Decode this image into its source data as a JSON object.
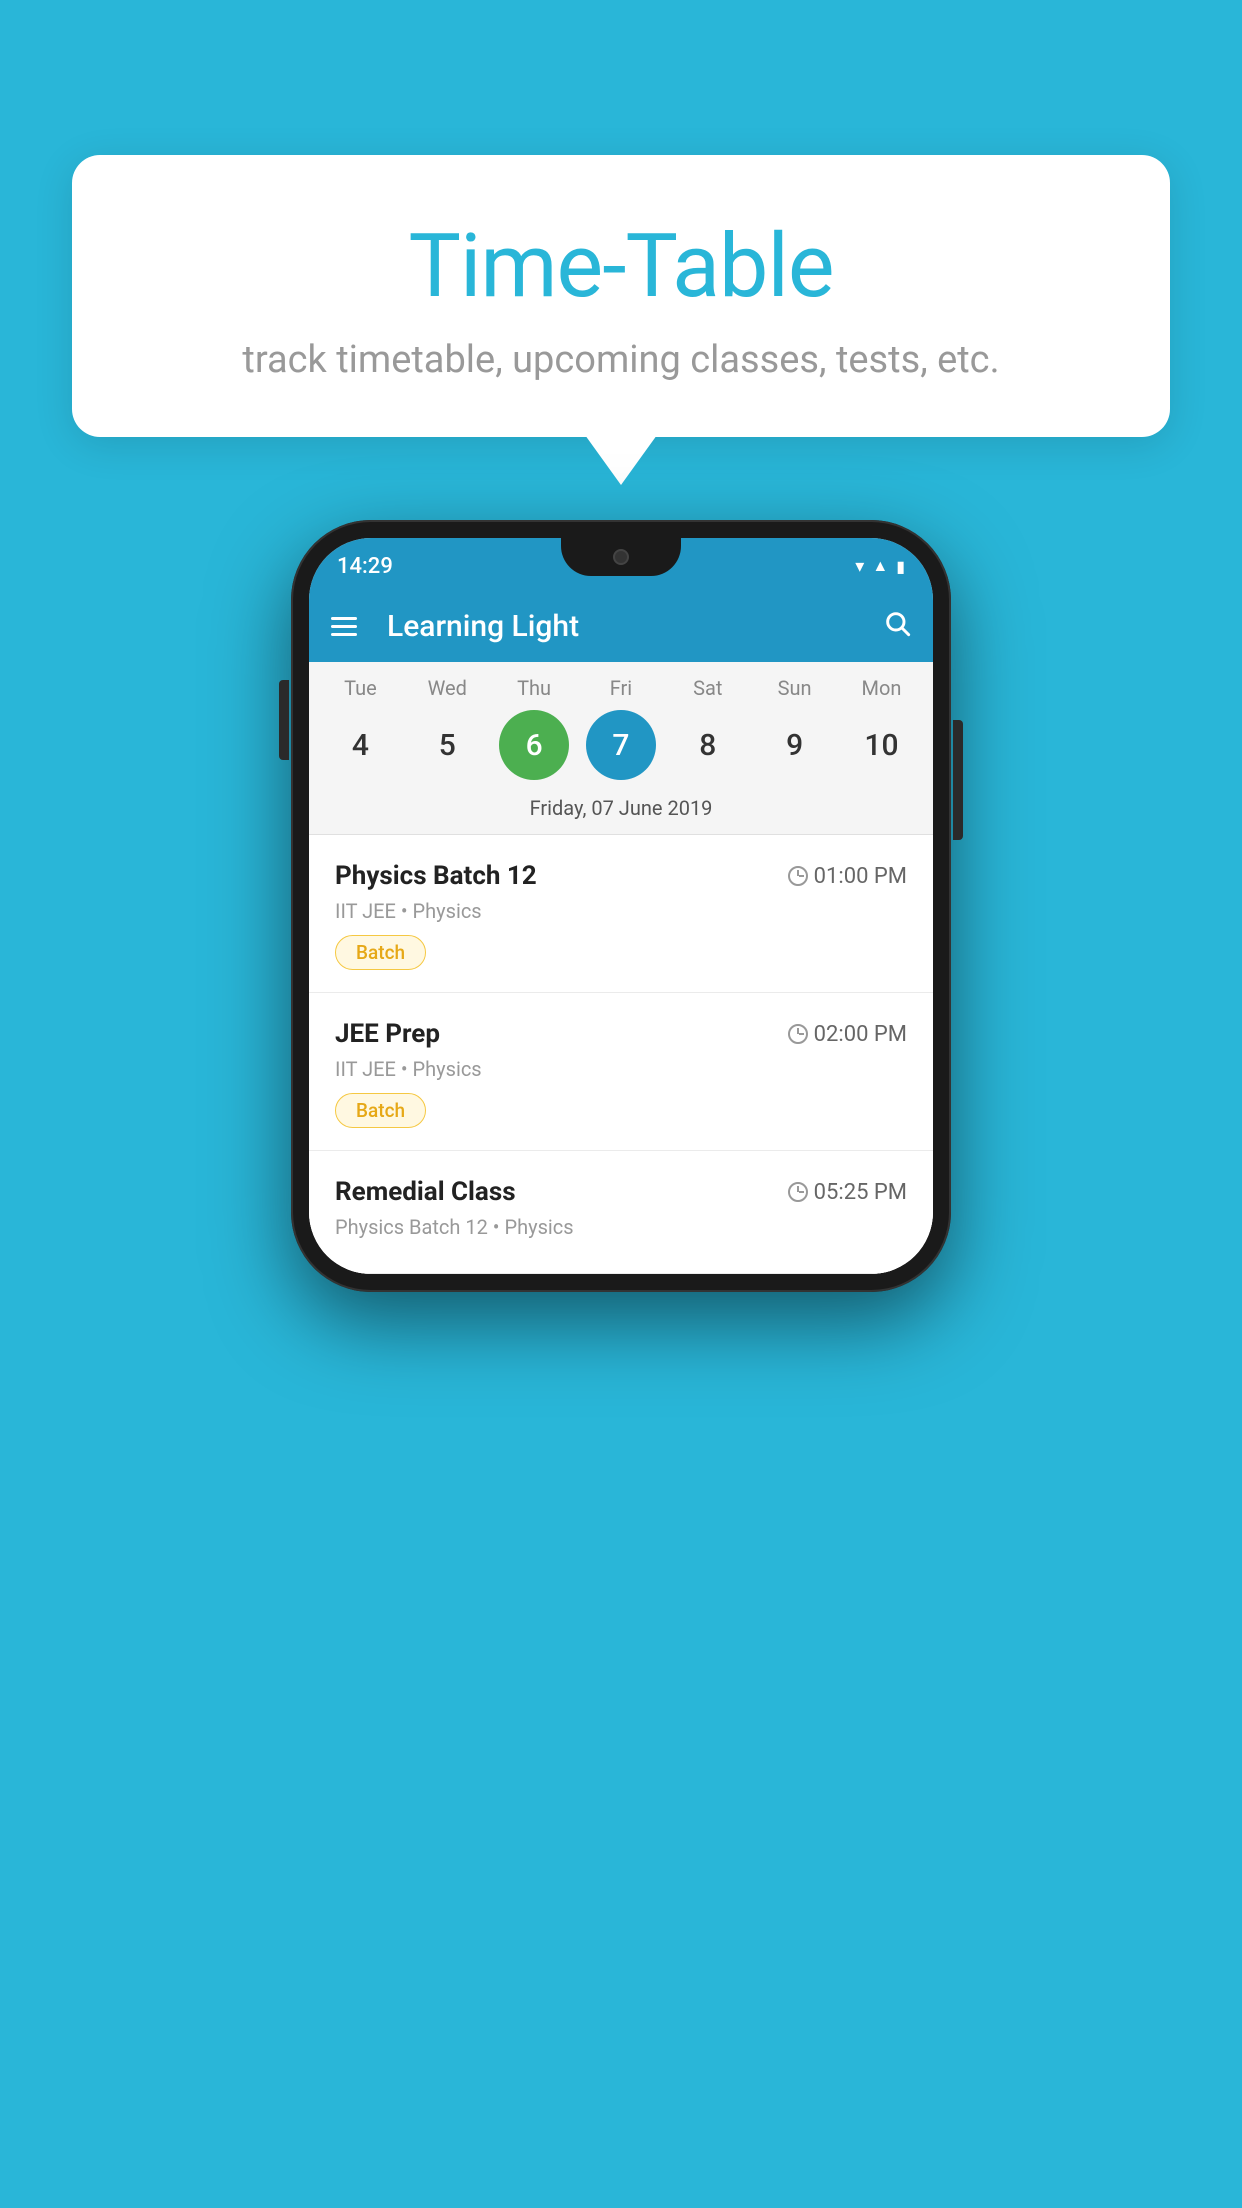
{
  "background": {
    "color": "#29b6d8"
  },
  "tooltip": {
    "title": "Time-Table",
    "subtitle": "track timetable, upcoming classes, tests, etc."
  },
  "phone": {
    "statusBar": {
      "time": "14:29"
    },
    "header": {
      "title": "Learning Light",
      "menuLabel": "menu",
      "searchLabel": "search"
    },
    "calendar": {
      "days": [
        "Tue",
        "Wed",
        "Thu",
        "Fri",
        "Sat",
        "Sun",
        "Mon"
      ],
      "dates": [
        "4",
        "5",
        "6",
        "7",
        "8",
        "9",
        "10"
      ],
      "todayIndex": 2,
      "selectedIndex": 3,
      "selectedDateLabel": "Friday, 07 June 2019"
    },
    "classes": [
      {
        "name": "Physics Batch 12",
        "time": "01:00 PM",
        "meta": "IIT JEE • Physics",
        "tag": "Batch"
      },
      {
        "name": "JEE Prep",
        "time": "02:00 PM",
        "meta": "IIT JEE • Physics",
        "tag": "Batch"
      },
      {
        "name": "Remedial Class",
        "time": "05:25 PM",
        "meta": "Physics Batch 12 • Physics",
        "tag": ""
      }
    ]
  }
}
